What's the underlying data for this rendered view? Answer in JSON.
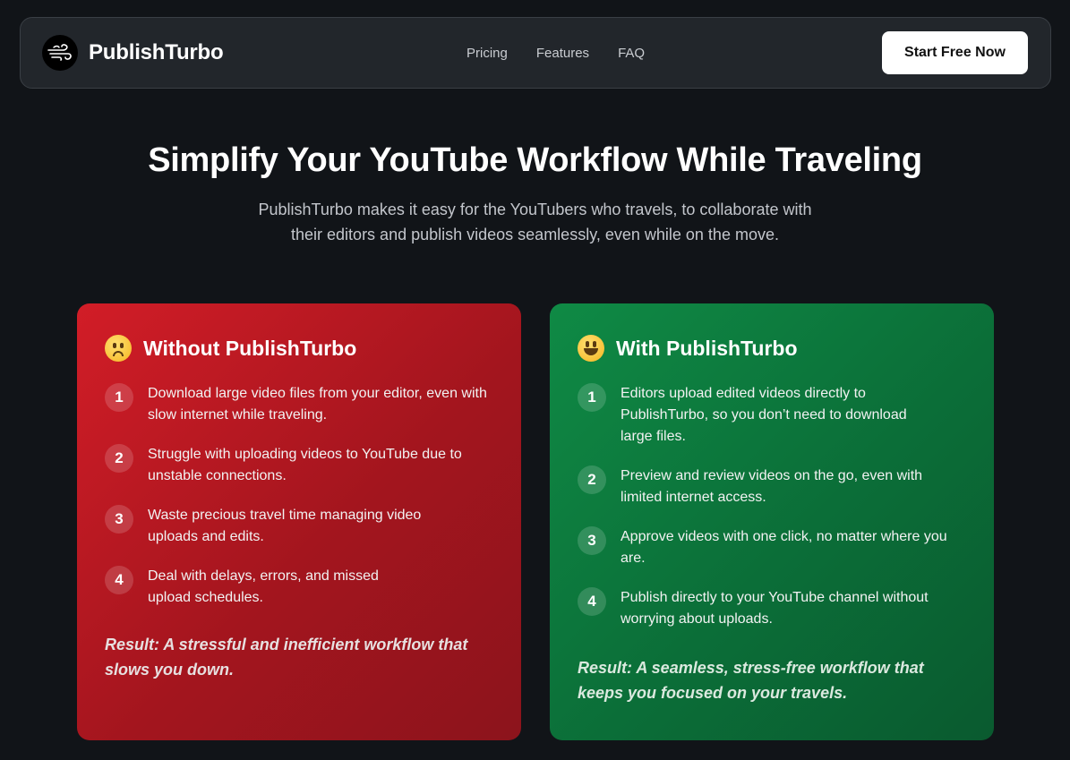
{
  "header": {
    "brand": "PublishTurbo",
    "nav": [
      "Pricing",
      "Features",
      "FAQ"
    ],
    "cta": "Start Free Now"
  },
  "hero": {
    "title": "Simplify Your YouTube Workflow While Traveling",
    "subtitle": "PublishTurbo makes it easy for the YouTubers who travels, to collaborate with their editors and publish videos seamlessly, even while on the move."
  },
  "without": {
    "title": "Without PublishTurbo",
    "emoji": "sad-face-icon",
    "accent": "#c81d25",
    "steps": [
      {
        "num": "1",
        "text": "Download large video files from your editor, even with slow internet while traveling."
      },
      {
        "num": "2",
        "text": "Struggle with uploading videos to YouTube due to unstable connections."
      },
      {
        "num": "3",
        "text": "Waste precious travel time managing video uploads and edits."
      },
      {
        "num": "4",
        "text": "Deal with delays, errors, and missed upload schedules."
      }
    ],
    "result": "Result: A stressful and inefficient workflow that slows you down."
  },
  "with": {
    "title": "With PublishTurbo",
    "emoji": "smiley-face-icon",
    "accent": "#0e7e40",
    "steps": [
      {
        "num": "1",
        "text": "Editors upload edited videos directly to PublishTurbo, so you don’t need to download large files."
      },
      {
        "num": "2",
        "text": "Preview and review videos on the go, even with limited internet access."
      },
      {
        "num": "3",
        "text": "Approve videos with one click, no matter where you are."
      },
      {
        "num": "4",
        "text": "Publish directly to your YouTube channel without worrying about uploads."
      }
    ],
    "result": "Result: A seamless, stress-free workflow that keeps you focused on your travels."
  }
}
